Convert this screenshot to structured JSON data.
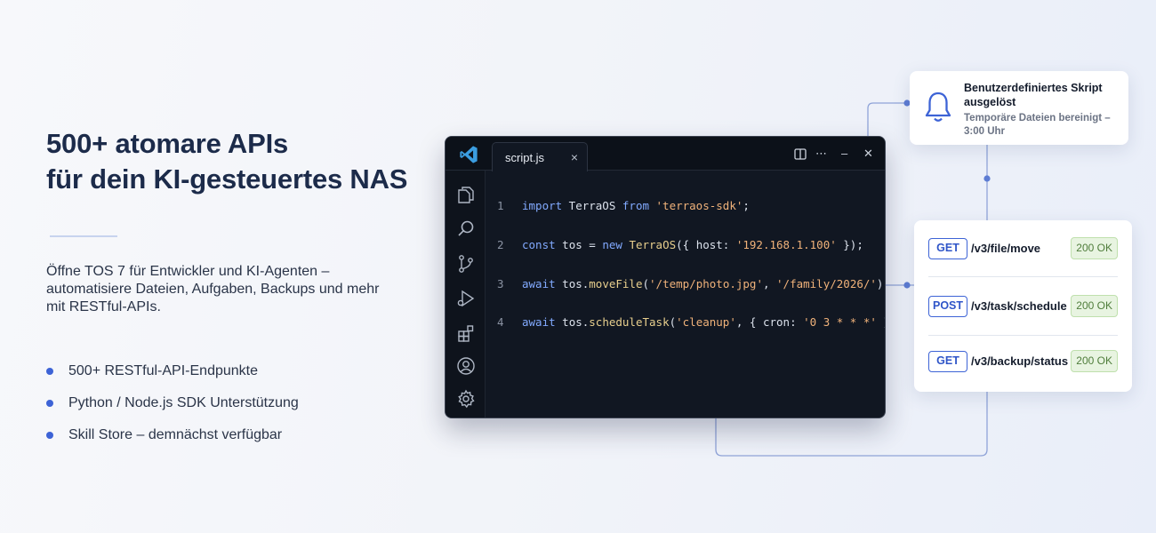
{
  "hero": {
    "title_line1": "500+ atomare APIs",
    "title_line2": "für dein KI-gesteuertes NAS",
    "description": "Öffne TOS 7 für Entwickler und KI-Agenten – automatisiere Dateien, Aufgaben, Backups und mehr mit RESTful-APIs.",
    "bullets": [
      "500+ RESTful-API-Endpunkte",
      "Python / Node.js SDK Unterstützung",
      "Skill Store – demnächst verfügbar"
    ]
  },
  "editor": {
    "app_icon": "vscode-logo-icon",
    "tab": {
      "label": "script.js",
      "close": "×"
    },
    "window_controls": {
      "split": "split-editor-icon",
      "more": "⋯",
      "minimize": "–",
      "close": "✕"
    },
    "activity_bar": [
      "files-icon",
      "search-icon",
      "source-control-icon",
      "run-debug-icon",
      "extensions-icon",
      "account-icon",
      "settings-gear-icon"
    ],
    "code_lines": [
      {
        "number": "1",
        "tokens": [
          {
            "t": "import",
            "c": "kw"
          },
          {
            "t": " TerraOS ",
            "c": "plain"
          },
          {
            "t": "from",
            "c": "kw"
          },
          {
            "t": " ",
            "c": "plain"
          },
          {
            "t": "'terraos-sdk'",
            "c": "str"
          },
          {
            "t": ";",
            "c": "plain"
          }
        ]
      },
      {
        "number": "2",
        "tokens": [
          {
            "t": "const",
            "c": "kw"
          },
          {
            "t": " tos = ",
            "c": "plain"
          },
          {
            "t": "new",
            "c": "kw"
          },
          {
            "t": " ",
            "c": "plain"
          },
          {
            "t": "TerraOS",
            "c": "fn"
          },
          {
            "t": "({ host: ",
            "c": "plain"
          },
          {
            "t": "'192.168.1.100'",
            "c": "str"
          },
          {
            "t": " });",
            "c": "plain"
          }
        ]
      },
      {
        "number": "3",
        "tokens": [
          {
            "t": "await",
            "c": "kw"
          },
          {
            "t": " tos.",
            "c": "plain"
          },
          {
            "t": "moveFile",
            "c": "fn"
          },
          {
            "t": "(",
            "c": "plain"
          },
          {
            "t": "'/temp/photo.jpg'",
            "c": "str"
          },
          {
            "t": ", ",
            "c": "plain"
          },
          {
            "t": "'/family/2026/'",
            "c": "str"
          },
          {
            "t": ");",
            "c": "plain"
          }
        ]
      },
      {
        "number": "4",
        "tokens": [
          {
            "t": "await",
            "c": "kw"
          },
          {
            "t": " tos.",
            "c": "plain"
          },
          {
            "t": "scheduleTask",
            "c": "fn"
          },
          {
            "t": "(",
            "c": "plain"
          },
          {
            "t": "'cleanup'",
            "c": "str"
          },
          {
            "t": ", { cron: ",
            "c": "plain"
          },
          {
            "t": "'0 3 * * *'",
            "c": "str"
          },
          {
            "t": " });",
            "c": "plain"
          }
        ]
      }
    ]
  },
  "notification": {
    "icon": "bell-icon",
    "title": "Benutzerdefiniertes Skript ausgelöst",
    "subtitle": "Temporäre Dateien bereinigt – 3:00 Uhr"
  },
  "api_calls": [
    {
      "method": "GET",
      "path": "/v3/file/move",
      "status": "200 OK"
    },
    {
      "method": "POST",
      "path": "/v3/task/schedule",
      "status": "200 OK"
    },
    {
      "method": "GET",
      "path": "/v3/backup/status",
      "status": "200 OK"
    }
  ],
  "colors": {
    "accent": "#3d63d6",
    "title": "#1c2b4a",
    "editor_bg": "#111722",
    "status_ok_bg": "#e8f4e1",
    "status_ok_text": "#4f7d3b",
    "connector": "#8fa3d8"
  }
}
